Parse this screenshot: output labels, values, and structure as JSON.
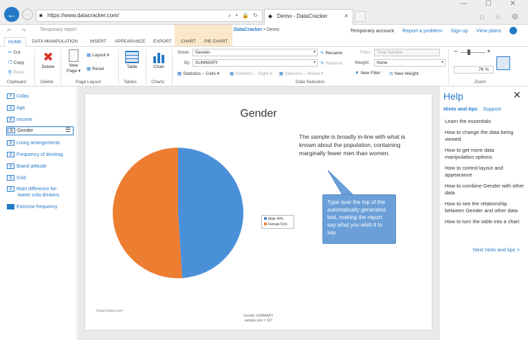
{
  "browser": {
    "url": "https://www.datacracker.com/",
    "tab_title": "Demo - DataCracker",
    "address_tools": "⌕ ▾ 🔒 ↻",
    "window_controls": "— ☐ ✕",
    "right_icons": "⌂ ☆ ⚙"
  },
  "app": {
    "report_title": "Temporary report",
    "brand": "DataCracker",
    "brand_sep": " • Demo",
    "account": "Temporary account",
    "links": [
      "Report a problem",
      "Sign up",
      "View plans"
    ],
    "help_mark": "?"
  },
  "ribbon_tabs": [
    "HOME",
    "DATA MANIPULATION",
    "INSERT",
    "APPEARANCE",
    "EXPORT",
    "CHART",
    "PIE CHART"
  ],
  "ribbon": {
    "clipboard": {
      "cut": "Cut",
      "copy": "Copy",
      "paste": "Paste",
      "label": "Clipboard"
    },
    "delete": {
      "button": "Delete",
      "label": "Delete"
    },
    "page_layout": {
      "new_page_1": "New",
      "new_page_2": "Page ▾",
      "layout": "Layout ▾",
      "reset": "Reset",
      "label": "Page Layout"
    },
    "tables": {
      "button": "Table",
      "label": "Tables"
    },
    "charts": {
      "button": "Chart",
      "label": "Charts"
    },
    "data_selection": {
      "show_label": "Show:",
      "show_value": "Gender",
      "by_label": "By:",
      "by_value": "SUMMARY",
      "rename_1": "Rename",
      "rename_2": "Rename",
      "stats_cells": "Statistics – Cells ▾",
      "stats_right": "Statistics – Right ▾",
      "stats_below": "Statistics – Below ▾",
      "filter_label": "Filter:",
      "filter_value": "Total Sample",
      "weight_label": "Weight:",
      "weight_value": "None",
      "new_filter": "New Filter",
      "new_weight": "New Weight",
      "label": "Data Selection"
    },
    "zoom": {
      "minus": "−",
      "plus": "+",
      "value": "76",
      "unit": "%",
      "label": "Zoom"
    }
  },
  "sidebar": {
    "items": [
      {
        "label": "Colas",
        "icon": "A"
      },
      {
        "label": "Age",
        "icon": "▥"
      },
      {
        "label": "Income",
        "icon": "▥"
      },
      {
        "label": "Gender",
        "icon": "▥"
      },
      {
        "label": "Living arrangements",
        "icon": "▥"
      },
      {
        "label": "Frequency of drinking",
        "icon": "▥"
      },
      {
        "label": "Brand attitude",
        "icon": "▥"
      },
      {
        "label": "Grid",
        "icon": "▥"
      },
      {
        "label": "Main difference be-",
        "label2": "tween cola drinkers",
        "icon": "▥"
      },
      {
        "label": "Exercise frequency",
        "icon": "▥"
      }
    ]
  },
  "report": {
    "title": "Gender",
    "commentary": "The sample is broadly in-line with what is known about the population, containing marginally fewer men than women.",
    "callout": "Type over the top of the automatically generated text, making the report say what you wish it to say.",
    "footer_left": "DataCracker.com",
    "footer_line1": "Gender SUMMARY",
    "footer_line2": "sample size = 327"
  },
  "chart_data": {
    "type": "pie",
    "title": "Gender",
    "categories": [
      "Male",
      "Female"
    ],
    "values": [
      49,
      51
    ],
    "legend_labels": [
      "Male 49%",
      "Female 51%"
    ],
    "colors": [
      "#4a90d9",
      "#ed7d31"
    ],
    "legend_position": "right"
  },
  "help": {
    "title": "Help",
    "close": "✕",
    "tab_hints": "Hints and tips",
    "tab_support": "Support",
    "items": [
      "Learn the essentials",
      "How to change the data being viewed",
      "How to get more data manipulation options",
      "How to control layout and appearance",
      "How to combine Gender with other data",
      "How to see the relationship between Gender and other data",
      "How to turn the table into a chart"
    ],
    "next": "Next hints and tips >"
  }
}
